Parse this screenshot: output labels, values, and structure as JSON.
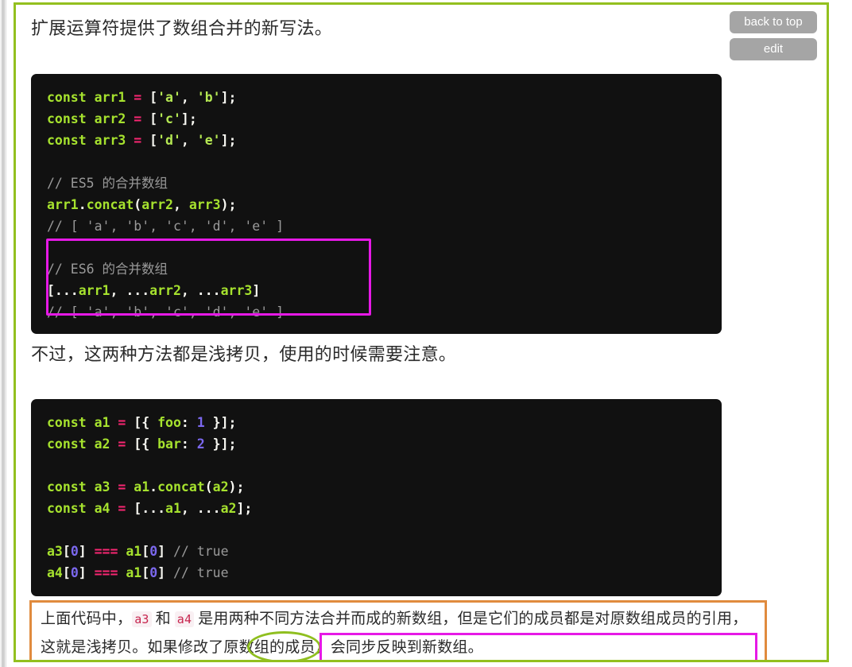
{
  "toolbar": {
    "back_to_top_label": "back to top",
    "edit_label": "edit"
  },
  "paragraphs": {
    "intro": "扩展运算符提供了数组合并的新写法。",
    "middle": "不过，这两种方法都是浅拷贝，使用的时候需要注意。"
  },
  "code_block_1": {
    "lines": [
      {
        "id": "l1",
        "segments": [
          {
            "t": "const",
            "c": "kw"
          },
          {
            "t": " ",
            "c": "pun"
          },
          {
            "t": "arr1",
            "c": "var"
          },
          {
            "t": " ",
            "c": "pun"
          },
          {
            "t": "=",
            "c": "op"
          },
          {
            "t": " [",
            "c": "pun"
          },
          {
            "t": "'a'",
            "c": "str"
          },
          {
            "t": ", ",
            "c": "pun"
          },
          {
            "t": "'b'",
            "c": "str"
          },
          {
            "t": "];",
            "c": "pun"
          }
        ]
      },
      {
        "id": "l2",
        "segments": [
          {
            "t": "const",
            "c": "kw"
          },
          {
            "t": " ",
            "c": "pun"
          },
          {
            "t": "arr2",
            "c": "var"
          },
          {
            "t": " ",
            "c": "pun"
          },
          {
            "t": "=",
            "c": "op"
          },
          {
            "t": " [",
            "c": "pun"
          },
          {
            "t": "'c'",
            "c": "str"
          },
          {
            "t": "];",
            "c": "pun"
          }
        ]
      },
      {
        "id": "l3",
        "segments": [
          {
            "t": "const",
            "c": "kw"
          },
          {
            "t": " ",
            "c": "pun"
          },
          {
            "t": "arr3",
            "c": "var"
          },
          {
            "t": " ",
            "c": "pun"
          },
          {
            "t": "=",
            "c": "op"
          },
          {
            "t": " [",
            "c": "pun"
          },
          {
            "t": "'d'",
            "c": "str"
          },
          {
            "t": ", ",
            "c": "pun"
          },
          {
            "t": "'e'",
            "c": "str"
          },
          {
            "t": "];",
            "c": "pun"
          }
        ]
      },
      {
        "id": "l4",
        "segments": []
      },
      {
        "id": "l5",
        "segments": [
          {
            "t": "// ES5 的合并数组",
            "c": "com"
          }
        ]
      },
      {
        "id": "l6",
        "segments": [
          {
            "t": "arr1",
            "c": "var"
          },
          {
            "t": ".",
            "c": "pun"
          },
          {
            "t": "concat",
            "c": "var"
          },
          {
            "t": "(",
            "c": "pun"
          },
          {
            "t": "arr2",
            "c": "var"
          },
          {
            "t": ", ",
            "c": "pun"
          },
          {
            "t": "arr3",
            "c": "var"
          },
          {
            "t": ");",
            "c": "pun"
          }
        ]
      },
      {
        "id": "l7",
        "segments": [
          {
            "t": "// [ 'a', 'b', 'c', 'd', 'e' ]",
            "c": "com"
          }
        ]
      },
      {
        "id": "l8",
        "segments": []
      },
      {
        "id": "l9",
        "segments": [
          {
            "t": "// ES6 的合并数组",
            "c": "com"
          }
        ]
      },
      {
        "id": "l10",
        "segments": [
          {
            "t": "[...",
            "c": "pun"
          },
          {
            "t": "arr1",
            "c": "var"
          },
          {
            "t": ", ...",
            "c": "pun"
          },
          {
            "t": "arr2",
            "c": "var"
          },
          {
            "t": ", ...",
            "c": "pun"
          },
          {
            "t": "arr3",
            "c": "var"
          },
          {
            "t": "]",
            "c": "pun"
          }
        ]
      },
      {
        "id": "l11",
        "segments": [
          {
            "t": "// [ 'a', 'b', 'c', 'd', 'e' ]",
            "c": "com"
          }
        ]
      }
    ],
    "highlight_box_color": "#e619e6"
  },
  "code_block_2": {
    "lines": [
      {
        "id": "m1",
        "segments": [
          {
            "t": "const",
            "c": "kw"
          },
          {
            "t": " ",
            "c": "pun"
          },
          {
            "t": "a1",
            "c": "var"
          },
          {
            "t": " ",
            "c": "pun"
          },
          {
            "t": "=",
            "c": "op"
          },
          {
            "t": " [{ ",
            "c": "pun"
          },
          {
            "t": "foo",
            "c": "var"
          },
          {
            "t": ": ",
            "c": "pun"
          },
          {
            "t": "1",
            "c": "num"
          },
          {
            "t": " }];",
            "c": "pun"
          }
        ]
      },
      {
        "id": "m2",
        "segments": [
          {
            "t": "const",
            "c": "kw"
          },
          {
            "t": " ",
            "c": "pun"
          },
          {
            "t": "a2",
            "c": "var"
          },
          {
            "t": " ",
            "c": "pun"
          },
          {
            "t": "=",
            "c": "op"
          },
          {
            "t": " [{ ",
            "c": "pun"
          },
          {
            "t": "bar",
            "c": "var"
          },
          {
            "t": ": ",
            "c": "pun"
          },
          {
            "t": "2",
            "c": "num"
          },
          {
            "t": " }];",
            "c": "pun"
          }
        ]
      },
      {
        "id": "m3",
        "segments": []
      },
      {
        "id": "m4",
        "segments": [
          {
            "t": "const",
            "c": "kw"
          },
          {
            "t": " ",
            "c": "pun"
          },
          {
            "t": "a3",
            "c": "var"
          },
          {
            "t": " ",
            "c": "pun"
          },
          {
            "t": "=",
            "c": "op"
          },
          {
            "t": " ",
            "c": "pun"
          },
          {
            "t": "a1",
            "c": "var"
          },
          {
            "t": ".",
            "c": "pun"
          },
          {
            "t": "concat",
            "c": "var"
          },
          {
            "t": "(",
            "c": "pun"
          },
          {
            "t": "a2",
            "c": "var"
          },
          {
            "t": ");",
            "c": "pun"
          }
        ]
      },
      {
        "id": "m5",
        "segments": [
          {
            "t": "const",
            "c": "kw"
          },
          {
            "t": " ",
            "c": "pun"
          },
          {
            "t": "a4",
            "c": "var"
          },
          {
            "t": " ",
            "c": "pun"
          },
          {
            "t": "=",
            "c": "op"
          },
          {
            "t": " [...",
            "c": "pun"
          },
          {
            "t": "a1",
            "c": "var"
          },
          {
            "t": ", ...",
            "c": "pun"
          },
          {
            "t": "a2",
            "c": "var"
          },
          {
            "t": "];",
            "c": "pun"
          }
        ]
      },
      {
        "id": "m6",
        "segments": []
      },
      {
        "id": "m7",
        "segments": [
          {
            "t": "a3",
            "c": "var"
          },
          {
            "t": "[",
            "c": "pun"
          },
          {
            "t": "0",
            "c": "num"
          },
          {
            "t": "] ",
            "c": "pun"
          },
          {
            "t": "===",
            "c": "op"
          },
          {
            "t": " ",
            "c": "pun"
          },
          {
            "t": "a1",
            "c": "var"
          },
          {
            "t": "[",
            "c": "pun"
          },
          {
            "t": "0",
            "c": "num"
          },
          {
            "t": "] ",
            "c": "pun"
          },
          {
            "t": "// true",
            "c": "com"
          }
        ]
      },
      {
        "id": "m8",
        "segments": [
          {
            "t": "a4",
            "c": "var"
          },
          {
            "t": "[",
            "c": "pun"
          },
          {
            "t": "0",
            "c": "num"
          },
          {
            "t": "] ",
            "c": "pun"
          },
          {
            "t": "===",
            "c": "op"
          },
          {
            "t": " ",
            "c": "pun"
          },
          {
            "t": "a1",
            "c": "var"
          },
          {
            "t": "[",
            "c": "pun"
          },
          {
            "t": "0",
            "c": "num"
          },
          {
            "t": "] ",
            "c": "pun"
          },
          {
            "t": "// true",
            "c": "com"
          }
        ]
      }
    ]
  },
  "note": {
    "line1_part1": "上面代码中，",
    "code_a3": "a3",
    "line1_part2": "和",
    "code_a4": "a4",
    "line1_part3": "是用两种不同方法合并而成的新数组，但是它们的成员都是对原",
    "line2_part1": "数组成员的引用，这就是",
    "ellipse_text": "浅拷贝。",
    "magenta_text": "如果修改了原数组的成员，会同步反映到新数组",
    "line2_end": "。",
    "border_color": "#e08b3e"
  },
  "annotations": {
    "frame_color": "#93c01f",
    "magenta_color": "#e619e6",
    "ellipse_color": "#8fbf1f",
    "orange_color": "#e08b3e"
  }
}
